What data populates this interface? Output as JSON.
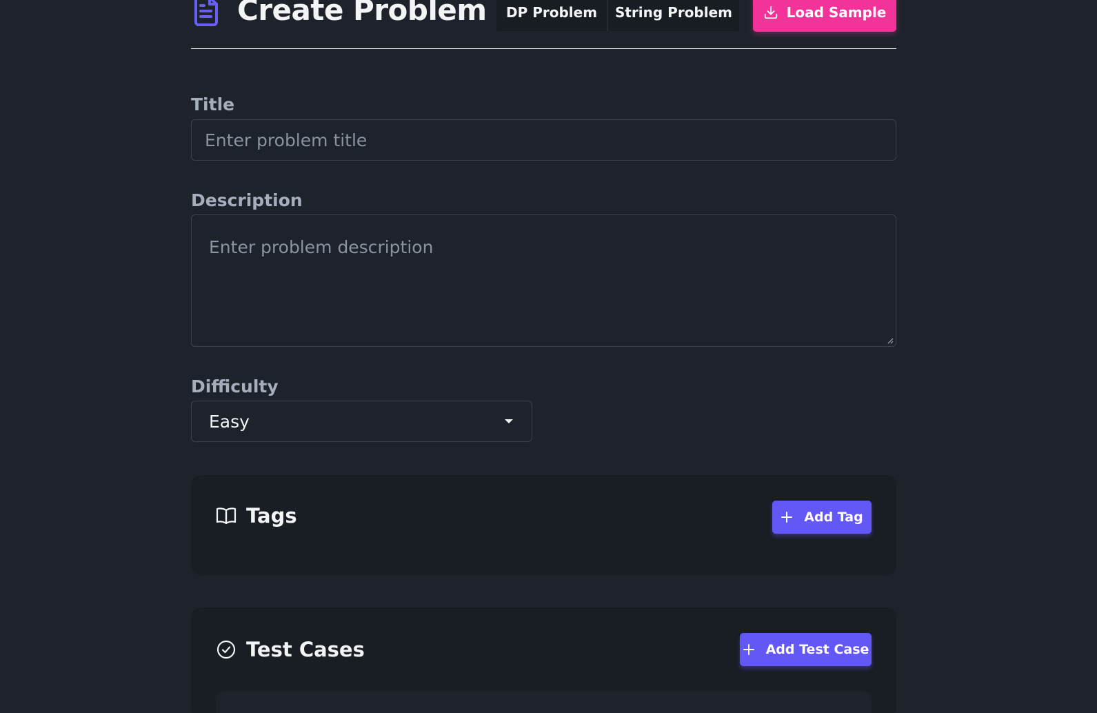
{
  "header": {
    "title": "Create Problem",
    "tabs": [
      {
        "label": "DP Problem"
      },
      {
        "label": "String Problem"
      }
    ],
    "load_sample_label": "Load Sample"
  },
  "form": {
    "title_label": "Title",
    "title_placeholder": "Enter problem title",
    "title_value": "",
    "description_label": "Description",
    "description_placeholder": "Enter problem description",
    "description_value": "",
    "difficulty_label": "Difficulty",
    "difficulty_value": "Easy"
  },
  "tags_section": {
    "title": "Tags",
    "add_label": "Add Tag"
  },
  "test_cases_section": {
    "title": "Test Cases",
    "add_label": "Add Test Case"
  },
  "colors": {
    "background": "#1e232b",
    "card": "#191d24",
    "accent_pink": "#f2339a",
    "accent_purple": "#6358f5",
    "icon_purple": "#6a5ff5"
  },
  "icons": [
    "document-icon",
    "download-icon",
    "book-open-icon",
    "plus-icon",
    "check-circle-icon",
    "chevron-down-icon"
  ]
}
